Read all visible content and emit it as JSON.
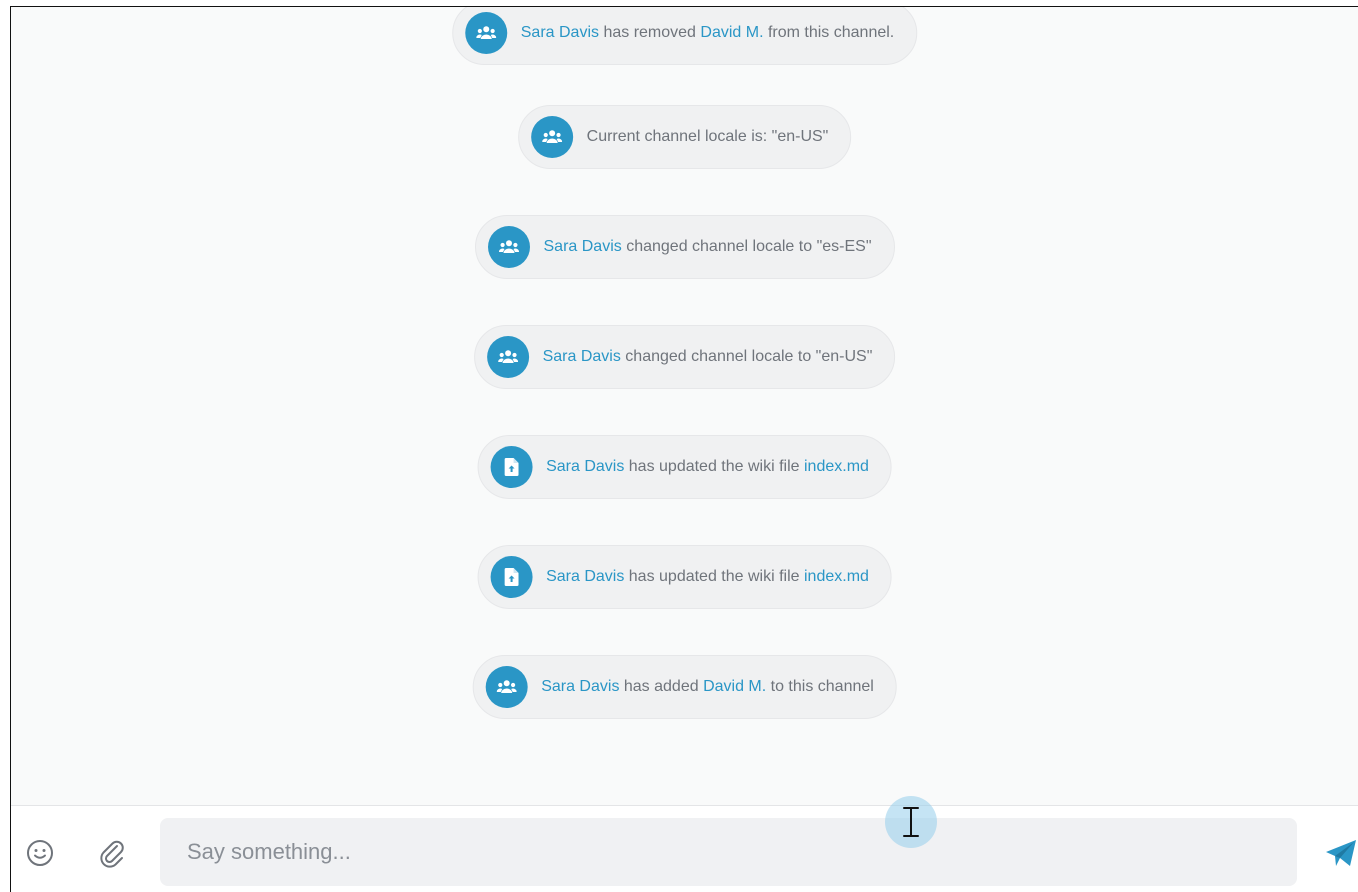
{
  "colors": {
    "accent": "#2a96c6",
    "pill_bg": "#f0f1f2",
    "muted_text": "#6f747b",
    "feed_bg": "#f9fafa"
  },
  "events": [
    {
      "icon": "users-icon",
      "parts": [
        {
          "text": "Sara Davis",
          "link": true
        },
        {
          "text": " has removed ",
          "link": false
        },
        {
          "text": "David M.",
          "link": true
        },
        {
          "text": " from this channel.",
          "link": false
        }
      ]
    },
    {
      "icon": "users-icon",
      "parts": [
        {
          "text": "Current channel locale is: \"en-US\"",
          "link": false
        }
      ]
    },
    {
      "icon": "users-icon",
      "parts": [
        {
          "text": "Sara Davis",
          "link": true
        },
        {
          "text": " changed channel locale to \"es-ES\"",
          "link": false
        }
      ]
    },
    {
      "icon": "users-icon",
      "parts": [
        {
          "text": "Sara Davis",
          "link": true
        },
        {
          "text": " changed channel locale to \"en-US\"",
          "link": false
        }
      ]
    },
    {
      "icon": "file-upload-icon",
      "parts": [
        {
          "text": "Sara Davis",
          "link": true
        },
        {
          "text": " has updated the wiki file ",
          "link": false
        },
        {
          "text": "index.md",
          "link": true
        }
      ]
    },
    {
      "icon": "file-upload-icon",
      "parts": [
        {
          "text": "Sara Davis",
          "link": true
        },
        {
          "text": " has updated the wiki file ",
          "link": false
        },
        {
          "text": "index.md",
          "link": true
        }
      ]
    },
    {
      "icon": "users-icon",
      "parts": [
        {
          "text": "Sara Davis",
          "link": true
        },
        {
          "text": " has added ",
          "link": false
        },
        {
          "text": "David M.",
          "link": true
        },
        {
          "text": " to this channel",
          "link": false
        }
      ]
    }
  ],
  "composer": {
    "placeholder": "Say something...",
    "value": "",
    "emoji_icon": "smiley-icon",
    "attach_icon": "paperclip-icon",
    "send_icon": "paper-plane-icon"
  }
}
